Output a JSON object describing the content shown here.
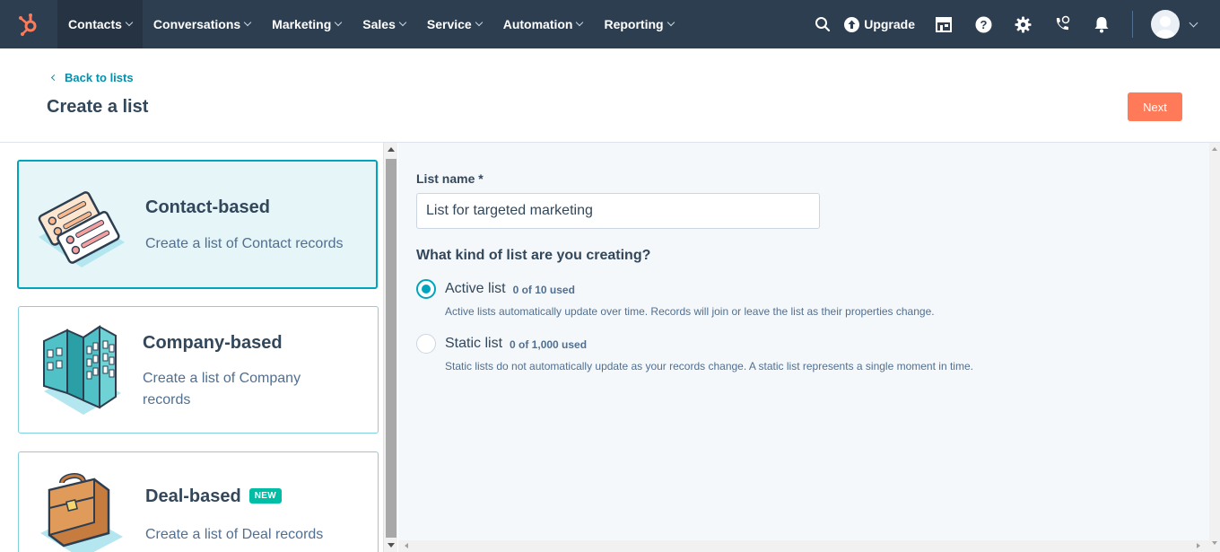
{
  "nav": {
    "items": [
      {
        "label": "Contacts"
      },
      {
        "label": "Conversations"
      },
      {
        "label": "Marketing"
      },
      {
        "label": "Sales"
      },
      {
        "label": "Service"
      },
      {
        "label": "Automation"
      },
      {
        "label": "Reporting"
      }
    ],
    "upgrade_label": "Upgrade",
    "icons": [
      "search-icon",
      "upgrade-icon",
      "marketplace-icon",
      "help-icon",
      "settings-icon",
      "calling-icon",
      "notifications-icon",
      "avatar"
    ]
  },
  "header": {
    "back_label": "Back to lists",
    "title": "Create a list",
    "next_label": "Next"
  },
  "cards": [
    {
      "title": "Contact-based",
      "desc": "Create a list of Contact records",
      "selected": true
    },
    {
      "title": "Company-based",
      "desc": "Create a list of Company records"
    },
    {
      "title": "Deal-based",
      "badge": "NEW",
      "desc": "Create a list of Deal records"
    }
  ],
  "form": {
    "name_label": "List name *",
    "name_value": "List for targeted marketing",
    "question": "What kind of list are you creating?",
    "options": [
      {
        "label": "Active list",
        "count": "0 of 10 used",
        "help": "Active lists automatically update over time. Records will join or leave the list as their properties change.",
        "checked": true
      },
      {
        "label": "Static list",
        "count": "0 of 1,000 used",
        "help": "Static lists do not automatically update as your records change. A static list represents a single moment in time.",
        "checked": false
      }
    ]
  },
  "colors": {
    "nav_bg": "#2d3e50",
    "accent_orange": "#ff7a59",
    "accent_teal": "#00a4bd",
    "badge_green": "#00bda5"
  }
}
